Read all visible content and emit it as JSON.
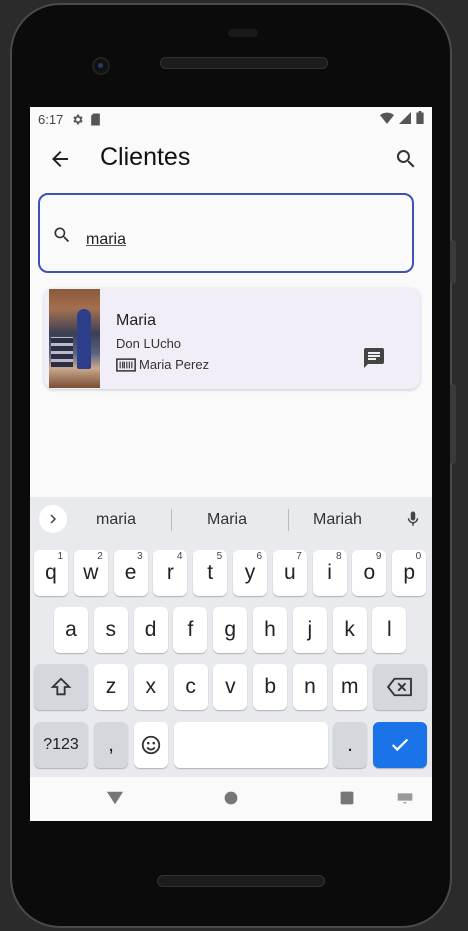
{
  "status": {
    "time": "6:17"
  },
  "appbar": {
    "title": "Clientes"
  },
  "search": {
    "value": "maria"
  },
  "results": [
    {
      "name": "Maria",
      "store": "Don LUcho",
      "owner": "Maria Perez"
    }
  ],
  "keyboard": {
    "suggestions": [
      "maria",
      "Maria",
      "Mariah"
    ],
    "row1": [
      {
        "k": "q",
        "h": "1"
      },
      {
        "k": "w",
        "h": "2"
      },
      {
        "k": "e",
        "h": "3"
      },
      {
        "k": "r",
        "h": "4"
      },
      {
        "k": "t",
        "h": "5"
      },
      {
        "k": "y",
        "h": "6"
      },
      {
        "k": "u",
        "h": "7"
      },
      {
        "k": "i",
        "h": "8"
      },
      {
        "k": "o",
        "h": "9"
      },
      {
        "k": "p",
        "h": "0"
      }
    ],
    "row2": [
      "a",
      "s",
      "d",
      "f",
      "g",
      "h",
      "j",
      "k",
      "l"
    ],
    "row3": [
      "z",
      "x",
      "c",
      "v",
      "b",
      "n",
      "m"
    ],
    "symbols_label": "?123",
    "comma": ",",
    "period": "."
  },
  "colors": {
    "accent": "#3f51b5",
    "keyboard_action": "#1a73e8",
    "card_bg": "#f1eef8"
  }
}
